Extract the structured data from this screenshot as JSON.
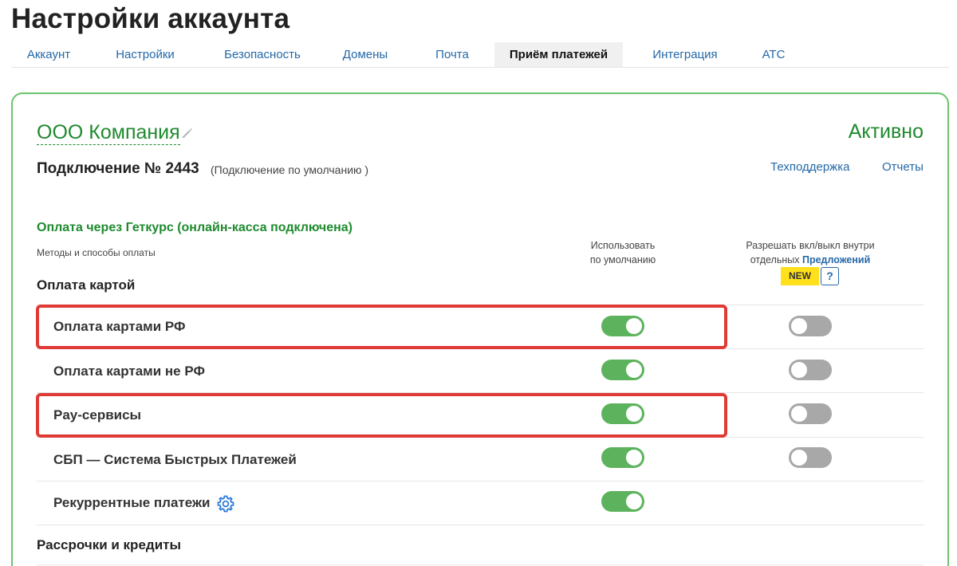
{
  "page": {
    "title": "Настройки аккаунта"
  },
  "tabs": [
    {
      "label": "Аккаунт"
    },
    {
      "label": "Настройки"
    },
    {
      "label": "Безопасность"
    },
    {
      "label": "Домены"
    },
    {
      "label": "Почта"
    },
    {
      "label": "Приём платежей",
      "active": true
    },
    {
      "label": "Интеграция"
    },
    {
      "label": "АТС"
    }
  ],
  "company": {
    "name": "ООО Компания",
    "status": "Активно"
  },
  "connection": {
    "title": "Подключение № 2443",
    "subtitle": "(Подключение по умолчанию )"
  },
  "links": {
    "support": "Техподдержка",
    "reports": "Отчеты"
  },
  "payment": {
    "section_title": "Оплата через Геткурс (онлайн-касса подключена)",
    "methods_label": "Методы и способы оплаты",
    "col_default": {
      "line1": "Использовать",
      "line2": "по умолчанию"
    },
    "col_offers": {
      "line1": "Разрешать вкл/выкл внутри",
      "line2_prefix": "отдельных",
      "line2_link": "Предложений",
      "badge": "NEW",
      "help": "?"
    }
  },
  "groups": {
    "card": "Оплата картой",
    "installments": "Рассрочки и кредиты"
  },
  "rows": [
    {
      "label": "Оплата картами РФ",
      "default_on": true,
      "offers_on": false,
      "highlighted": true
    },
    {
      "label": "Оплата картами не РФ",
      "default_on": true,
      "offers_on": false,
      "highlighted": false
    },
    {
      "label": "Pay-сервисы",
      "default_on": true,
      "offers_on": false,
      "highlighted": true
    },
    {
      "label": "СБП — Система Быстрых Платежей",
      "default_on": true,
      "offers_on": false,
      "highlighted": false
    },
    {
      "label": "Рекуррентные платежи",
      "default_on": true,
      "offers_on": null,
      "highlighted": false,
      "icon": "gear-icon"
    }
  ],
  "colors": {
    "accent_green": "#1e8a2e",
    "toggle_on": "#5db35d",
    "toggle_off": "#a8a8a8",
    "link_blue": "#2468a8",
    "highlight_red": "#e03a36",
    "badge_yellow": "#ffe01a"
  }
}
